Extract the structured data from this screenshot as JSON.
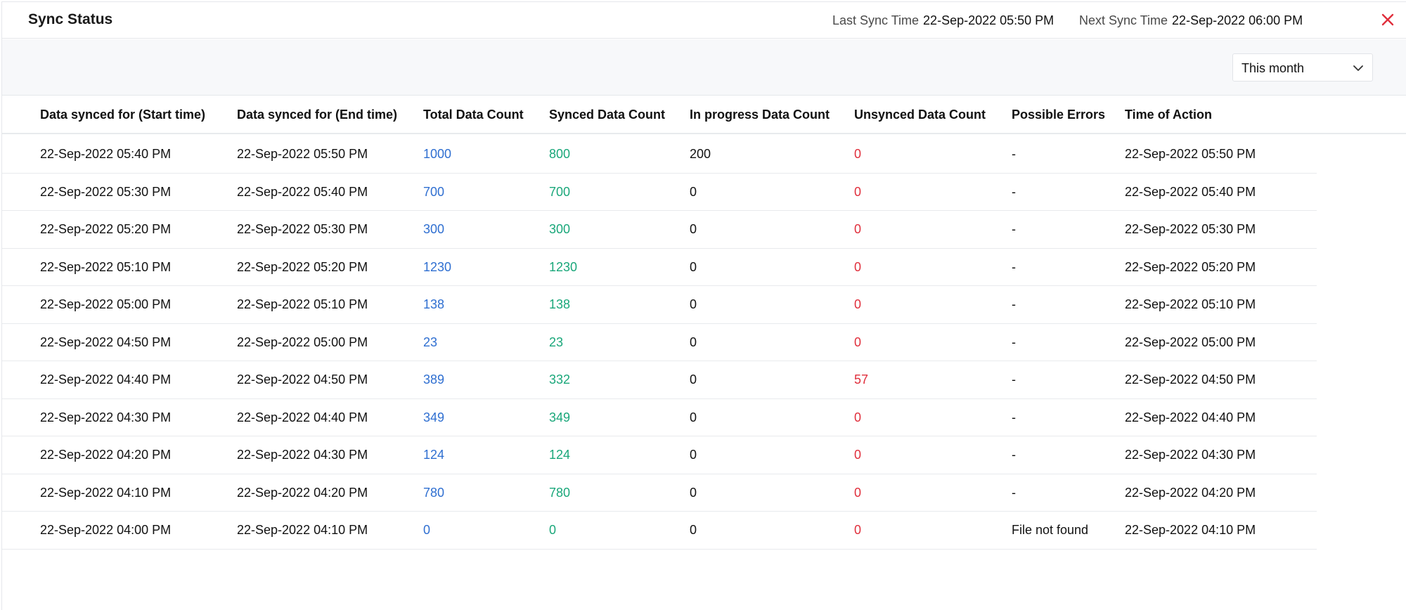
{
  "header": {
    "title": "Sync Status",
    "last_sync_label": "Last Sync Time",
    "last_sync_value": "22-Sep-2022 05:50 PM",
    "next_sync_label": "Next Sync Time",
    "next_sync_value": "22-Sep-2022 06:00 PM",
    "close_icon": "close-icon"
  },
  "filter": {
    "selected": "This month",
    "chevron_icon": "chevron-down-icon"
  },
  "colors": {
    "total": "#2f6fd1",
    "synced": "#1aa77a",
    "unsynced": "#e02f3c",
    "close": "#e02f3c"
  },
  "table": {
    "columns": [
      "Data synced for (Start time)",
      "Data synced for (End time)",
      "Total Data Count",
      "Synced Data Count",
      "In progress Data Count",
      "Unsynced Data Count",
      "Possible Errors",
      "Time of Action"
    ],
    "rows": [
      [
        "22-Sep-2022 05:40 PM",
        "22-Sep-2022 05:50 PM",
        "1000",
        "800",
        "200",
        "0",
        "-",
        "22-Sep-2022 05:50 PM"
      ],
      [
        "22-Sep-2022 05:30 PM",
        "22-Sep-2022 05:40 PM",
        "700",
        "700",
        "0",
        "0",
        "-",
        "22-Sep-2022 05:40 PM"
      ],
      [
        "22-Sep-2022 05:20 PM",
        "22-Sep-2022 05:30 PM",
        "300",
        "300",
        "0",
        "0",
        "-",
        "22-Sep-2022 05:30 PM"
      ],
      [
        "22-Sep-2022 05:10 PM",
        "22-Sep-2022 05:20 PM",
        "1230",
        "1230",
        "0",
        "0",
        "-",
        "22-Sep-2022 05:20 PM"
      ],
      [
        "22-Sep-2022 05:00 PM",
        "22-Sep-2022 05:10 PM",
        "138",
        "138",
        "0",
        "0",
        "-",
        "22-Sep-2022 05:10 PM"
      ],
      [
        "22-Sep-2022 04:50 PM",
        "22-Sep-2022 05:00 PM",
        "23",
        "23",
        "0",
        "0",
        "-",
        "22-Sep-2022 05:00 PM"
      ],
      [
        "22-Sep-2022 04:40 PM",
        "22-Sep-2022 04:50 PM",
        "389",
        "332",
        "0",
        "57",
        "-",
        "22-Sep-2022 04:50 PM"
      ],
      [
        "22-Sep-2022 04:30 PM",
        "22-Sep-2022 04:40 PM",
        "349",
        "349",
        "0",
        "0",
        "-",
        "22-Sep-2022 04:40 PM"
      ],
      [
        "22-Sep-2022 04:20 PM",
        "22-Sep-2022 04:30 PM",
        "124",
        "124",
        "0",
        "0",
        "-",
        "22-Sep-2022 04:30 PM"
      ],
      [
        "22-Sep-2022 04:10 PM",
        "22-Sep-2022 04:20 PM",
        "780",
        "780",
        "0",
        "0",
        "-",
        "22-Sep-2022 04:20 PM"
      ],
      [
        "22-Sep-2022 04:00 PM",
        "22-Sep-2022 04:10 PM",
        "0",
        "0",
        "0",
        "0",
        "File not found",
        "22-Sep-2022 04:10 PM"
      ]
    ]
  }
}
